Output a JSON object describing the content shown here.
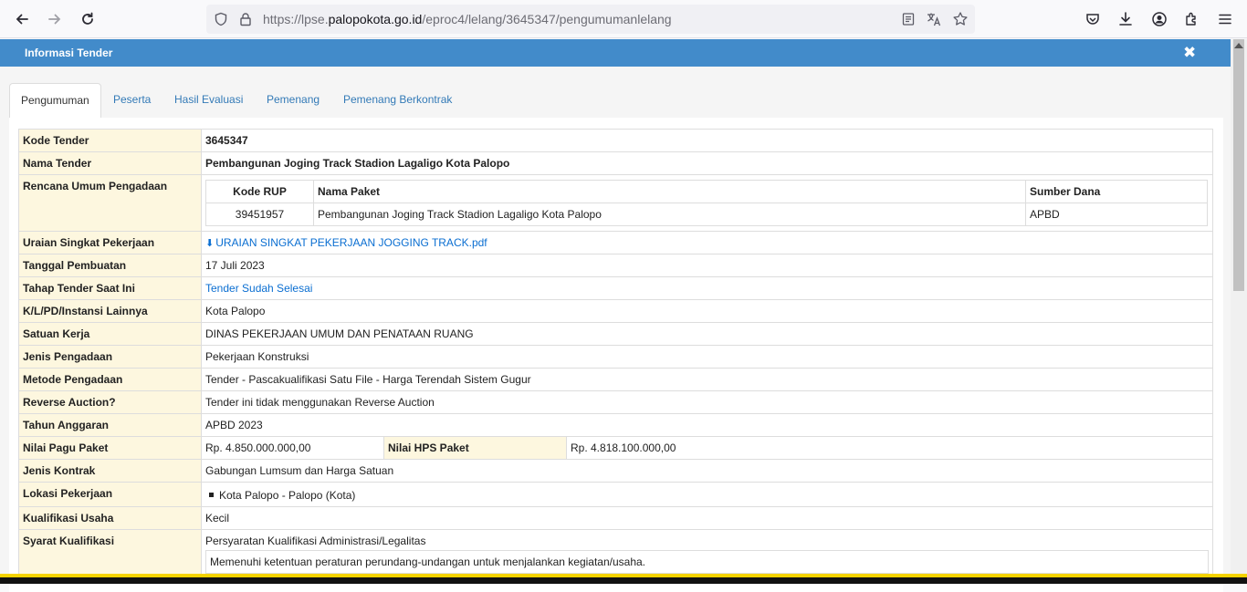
{
  "browser": {
    "url_prefix": "https://lpse.",
    "url_host": "palopokota.go.id",
    "url_path": "/eproc4/lelang/3645347/pengumumanlelang"
  },
  "modal": {
    "title": "Informasi Tender",
    "close_glyph": "✖"
  },
  "tabs": [
    "Pengumuman",
    "Peserta",
    "Hasil Evaluasi",
    "Pemenang",
    "Pemenang Berkontrak"
  ],
  "info": {
    "kode_tender": {
      "label": "Kode Tender",
      "value": "3645347"
    },
    "nama_tender": {
      "label": "Nama Tender",
      "value": "Pembangunan Joging Track Stadion Lagaligo Kota Palopo"
    },
    "rup": {
      "label": "Rencana Umum Pengadaan",
      "headers": [
        "Kode RUP",
        "Nama Paket",
        "Sumber Dana"
      ],
      "row": {
        "kode": "39451957",
        "nama": "Pembangunan Joging Track Stadion Lagaligo Kota Palopo",
        "sumber": "APBD"
      }
    },
    "uraian": {
      "label": "Uraian Singkat Pekerjaan",
      "value": "URAIAN SINGKAT PEKERJAAN JOGGING TRACK.pdf"
    },
    "tanggal": {
      "label": "Tanggal Pembuatan",
      "value": "17 Juli 2023"
    },
    "tahap": {
      "label": "Tahap Tender Saat Ini",
      "value": "Tender Sudah Selesai"
    },
    "klpd": {
      "label": "K/L/PD/Instansi Lainnya",
      "value": "Kota Palopo"
    },
    "satker": {
      "label": "Satuan Kerja",
      "value": "DINAS PEKERJAAN UMUM DAN PENATAAN RUANG"
    },
    "jenis_pengadaan": {
      "label": "Jenis Pengadaan",
      "value": "Pekerjaan Konstruksi"
    },
    "metode": {
      "label": "Metode Pengadaan",
      "value": "Tender - Pascakualifikasi Satu File - Harga Terendah Sistem Gugur"
    },
    "reverse": {
      "label": "Reverse Auction?",
      "value": "Tender ini tidak menggunakan Reverse Auction"
    },
    "tahun": {
      "label": "Tahun Anggaran",
      "value": "APBD 2023"
    },
    "pagu": {
      "label": "Nilai Pagu Paket",
      "value": "Rp. 4.850.000.000,00",
      "hps_label": "Nilai HPS Paket",
      "hps_value": "Rp. 4.818.100.000,00"
    },
    "kontrak": {
      "label": "Jenis Kontrak",
      "value": "Gabungan Lumsum dan Harga Satuan"
    },
    "lokasi": {
      "label": "Lokasi Pekerjaan",
      "value": "Kota Palopo - Palopo (Kota)"
    },
    "kualifikasi": {
      "label": "Kualifikasi Usaha",
      "value": "Kecil"
    },
    "syarat": {
      "label": "Syarat Kualifikasi",
      "heading": "Persyaratan Kualifikasi Administrasi/Legalitas",
      "item": "Memenuhi ketentuan peraturan perundang-undangan untuk menjalankan kegiatan/usaha."
    }
  }
}
